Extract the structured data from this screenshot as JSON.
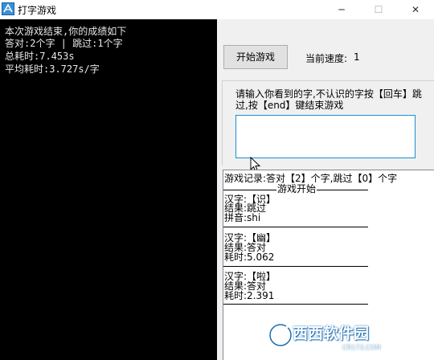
{
  "window": {
    "title": "打字游戏",
    "minimize": "─",
    "maximize": "☐",
    "close": "✕"
  },
  "console": {
    "lines": [
      "本次游戏结束,你的成绩如下",
      "答对:2个字 | 跳过:1个字",
      "总耗时:7.453s",
      "平均耗时:3.727s/字"
    ]
  },
  "controls": {
    "start_button": "开始游戏",
    "speed_label": "当前速度:",
    "speed_value": "1",
    "instruction": "请输入你看到的字,不认识的字按【回车】跳过,按【end】键结束游戏",
    "input_value": ""
  },
  "log": {
    "summary": "游戏记录:答对【2】个字,跳过【0】个字",
    "header": "游戏开始",
    "entries": [
      {
        "char_line": "汉字:【识】",
        "result_line": "结果:跳过",
        "extra_line": "拼音:shi"
      },
      {
        "char_line": "汉字:【幽】",
        "result_line": "结果:答对",
        "extra_line": "耗时:5.062"
      },
      {
        "char_line": "汉字:【啦】",
        "result_line": "结果:答对",
        "extra_line": "耗时:2.391"
      }
    ]
  },
  "watermark": {
    "text": "西西软件园",
    "url": "CR173.COM"
  },
  "colors": {
    "console_bg": "#000000",
    "form_bg": "#f0f0f0",
    "input_border": "#1a8fd6",
    "watermark": "#1b6db3"
  }
}
